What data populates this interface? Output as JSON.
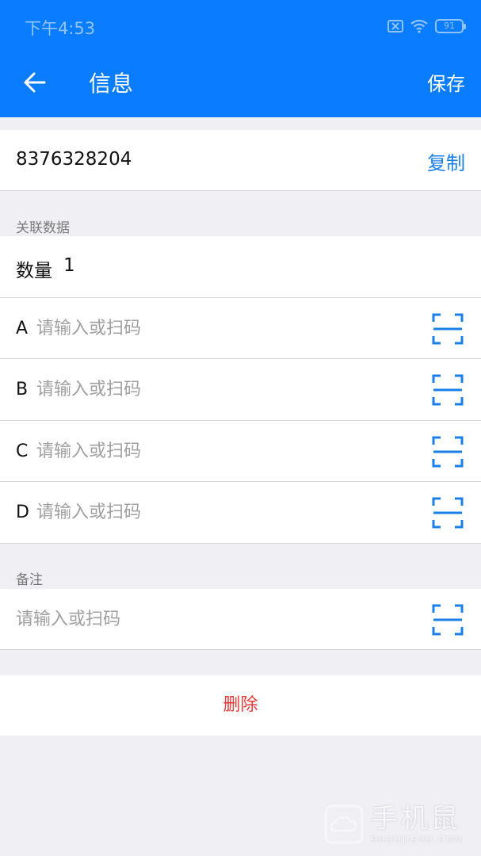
{
  "status_bar": {
    "time": "下午4:53",
    "battery_level": "91",
    "icons": [
      "sim-off-icon",
      "wifi-icon",
      "battery-icon"
    ]
  },
  "toolbar": {
    "title": "信息",
    "save_label": "保存",
    "back_icon": "arrow-left-icon"
  },
  "record": {
    "id": "8376328204",
    "copy_label": "复制"
  },
  "related_section": {
    "header": "关联数据",
    "quantity_label": "数量",
    "quantity_value": "1",
    "fields": [
      {
        "key": "A",
        "value": "",
        "placeholder": "请输入或扫码"
      },
      {
        "key": "B",
        "value": "",
        "placeholder": "请输入或扫码"
      },
      {
        "key": "C",
        "value": "",
        "placeholder": "请输入或扫码"
      },
      {
        "key": "D",
        "value": "",
        "placeholder": "请输入或扫码"
      }
    ]
  },
  "notes_section": {
    "header": "备注",
    "value": "",
    "placeholder": "请输入或扫码"
  },
  "delete_label": "删除",
  "watermark": {
    "cn": "手机鼠",
    "en": "SHOUJISHU.COM"
  },
  "colors": {
    "primary": "#0a7cff",
    "link": "#1a7fe8",
    "danger": "#e53935",
    "background": "#efeff4"
  }
}
